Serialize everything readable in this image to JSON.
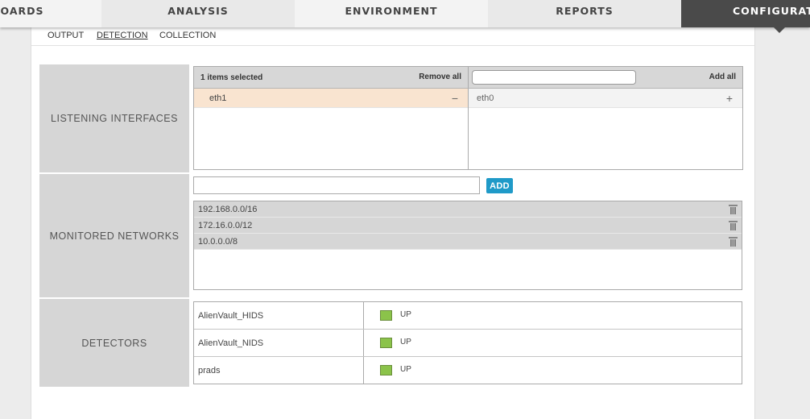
{
  "nav": {
    "tabs": [
      "BOARDS",
      "ANALYSIS",
      "ENVIRONMENT",
      "REPORTS",
      "CONFIGURATIO"
    ],
    "active": "CONFIGURATIO"
  },
  "subtabs": {
    "items": [
      "OUTPUT",
      "DETECTION",
      "COLLECTION"
    ],
    "active": "DETECTION"
  },
  "listening_interfaces": {
    "label": "LISTENING INTERFACES",
    "selected_count": "1 items selected",
    "remove_all": "Remove all",
    "add_all": "Add all",
    "search_value": "",
    "selected": [
      {
        "name": "eth1",
        "action": "−"
      }
    ],
    "available": [
      {
        "name": "eth0",
        "action": "+"
      }
    ]
  },
  "monitored_networks": {
    "label": "MONITORED NETWORKS",
    "input_value": "",
    "add_label": "ADD",
    "networks": [
      "192.168.0.0/16",
      "172.16.0.0/12",
      "10.0.0.0/8"
    ]
  },
  "detectors": {
    "label": "DETECTORS",
    "rows": [
      {
        "name": "AlienVault_HIDS",
        "status": "UP"
      },
      {
        "name": "AlienVault_NIDS",
        "status": "UP"
      },
      {
        "name": "prads",
        "status": "UP"
      }
    ]
  },
  "colors": {
    "accent": "#1f9ac8",
    "status_up": "#8bc34a",
    "nav_active": "#4a4a4a",
    "selected_row": "#f9e4d0"
  }
}
